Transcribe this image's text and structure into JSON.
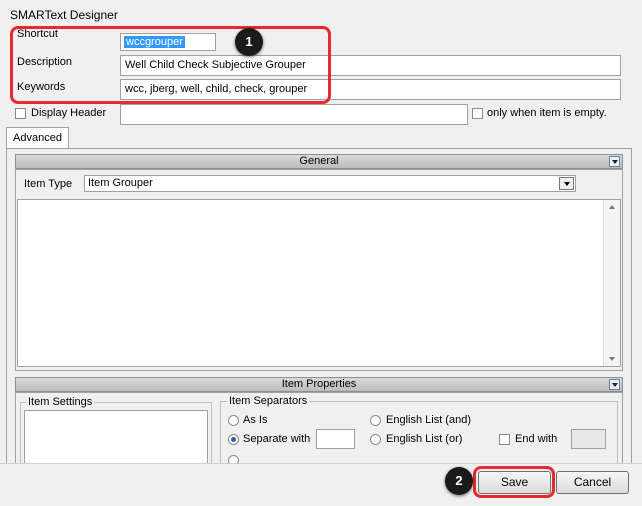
{
  "window": {
    "title": "SMARText Designer"
  },
  "header": {
    "shortcut_label": "Shortcut",
    "shortcut_value": "wccgrouper",
    "description_label": "Description",
    "description_value": "Well Child Check Subjective Grouper",
    "keywords_label": "Keywords",
    "keywords_value": "wcc, jberg, well, child, check, grouper",
    "display_header_label": "Display Header",
    "display_header_value": "",
    "only_when_empty_label": "only when item is empty."
  },
  "tabs": [
    {
      "label": "Advanced"
    }
  ],
  "general": {
    "title": "General",
    "item_type_label": "Item Type",
    "item_type_value": "Item Grouper"
  },
  "item_properties": {
    "title": "Item Properties",
    "item_settings_label": "Item Settings",
    "item_separators_label": "Item Separators",
    "options": {
      "as_is": "As Is",
      "english_and": "English List (and)",
      "separate_with": "Separate with",
      "english_or": "English List (or)",
      "end_with": "End with",
      "selected": "Separate with"
    }
  },
  "buttons": {
    "save": "Save",
    "cancel": "Cancel"
  },
  "annotations": {
    "step1": "1",
    "step2": "2"
  },
  "colors": {
    "highlight": "#e8292e",
    "selection": "#3399ff"
  }
}
